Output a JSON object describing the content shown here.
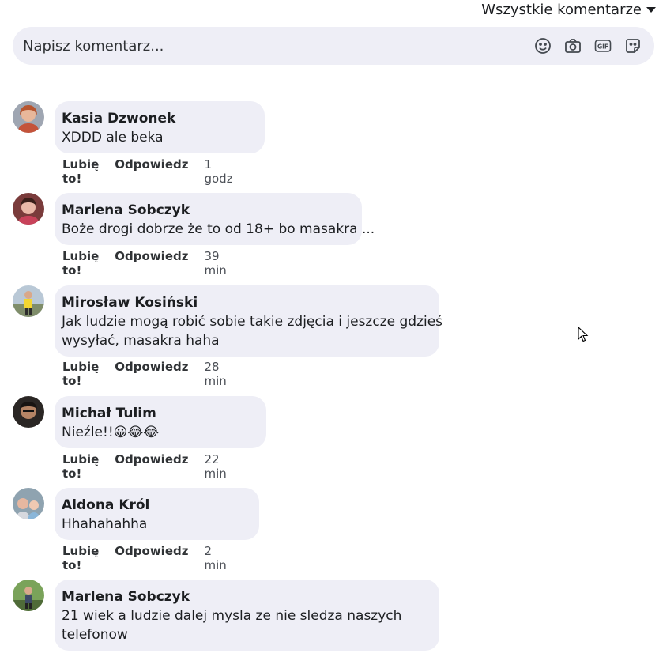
{
  "header": {
    "sort_label": "Wszystkie komentarze"
  },
  "composer": {
    "placeholder": "Napisz komentarz...",
    "icons": [
      "smiley-icon",
      "camera-icon",
      "gif-icon",
      "sticker-icon"
    ]
  },
  "actions": {
    "like": "Lubię to!",
    "reply": "Odpowiedz"
  },
  "comments": [
    {
      "author": "Kasia Dzwonek",
      "lines": [
        "XDDD ale beka"
      ],
      "time": "1 godz"
    },
    {
      "author": "Marlena Sobczyk",
      "lines": [
        "Boże drogi dobrze że to od 18+ bo masakra ..."
      ],
      "time": "39 min"
    },
    {
      "author": "Mirosław Kosiński",
      "lines": [
        "Jak ludzie mogą robić sobie takie zdjęcia i jeszcze gdzieś",
        "wysyłać, masakra haha"
      ],
      "time": "28 min"
    },
    {
      "author": "Michał Tulim",
      "lines": [
        "Nieźle!!😀😂😂"
      ],
      "time": "22 min"
    },
    {
      "author": "Aldona Król",
      "lines": [
        "Hhahahahha"
      ],
      "time": "2 min"
    },
    {
      "author": "Marlena Sobczyk",
      "lines": [
        "21 wiek a ludzie dalej mysla ze nie sledza naszych",
        "telefonow"
      ],
      "time": ""
    }
  ],
  "colors": {
    "bubble": "#eeeef6",
    "text": "#1c1e21"
  }
}
